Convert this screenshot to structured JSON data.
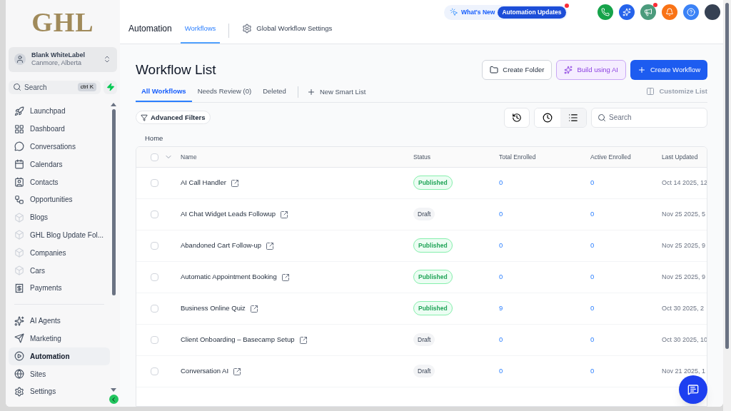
{
  "sidebar": {
    "logo": "GHL",
    "account": {
      "name": "Blank WhiteLabel",
      "location": "Canmore, Alberta"
    },
    "search": {
      "placeholder": "Search",
      "shortcut": "ctrl K"
    },
    "items": [
      {
        "label": "Launchpad",
        "selected": false
      },
      {
        "label": "Dashboard",
        "selected": false
      },
      {
        "label": "Conversations",
        "selected": false
      },
      {
        "label": "Calendars",
        "selected": false
      },
      {
        "label": "Contacts",
        "selected": false
      },
      {
        "label": "Opportunities",
        "selected": false
      },
      {
        "label": "Blogs",
        "selected": false
      },
      {
        "label": "GHL Blog Update Fol...",
        "selected": false
      },
      {
        "label": "Companies",
        "selected": false
      },
      {
        "label": "Cars",
        "selected": false
      },
      {
        "label": "Payments",
        "selected": false
      }
    ],
    "bottom_items": [
      {
        "label": "AI Agents",
        "selected": false
      },
      {
        "label": "Marketing",
        "selected": false
      },
      {
        "label": "Automation",
        "selected": true
      },
      {
        "label": "Sites",
        "selected": false
      },
      {
        "label": "Settings",
        "selected": false
      }
    ]
  },
  "header": {
    "title": "Automation",
    "tabs": [
      {
        "label": "Workflows",
        "selected": true
      },
      {
        "label": "Global Workflow Settings",
        "selected": false
      }
    ],
    "whats_new": "What's New",
    "updates": "Automation Updates",
    "icons": [
      {
        "kind": "phone",
        "color": "#16a34a",
        "dot": false
      },
      {
        "kind": "sparkle",
        "color": "#2563eb",
        "dot": false
      },
      {
        "kind": "megaphone",
        "color": "#4b9b7c",
        "dot": true
      },
      {
        "kind": "bell",
        "color": "#f97316",
        "dot": false
      },
      {
        "kind": "help",
        "color": "#3b82f6",
        "dot": false
      }
    ]
  },
  "page": {
    "title": "Workflow List",
    "buttons": [
      "Create Folder",
      "Build using AI",
      "Create Workflow"
    ],
    "tabs": [
      {
        "label": "All Workflows",
        "selected": true
      },
      {
        "label": "Needs Review (0)",
        "selected": false
      },
      {
        "label": "Deleted",
        "selected": false
      }
    ],
    "new_list": "New Smart List",
    "customize": "Customize List",
    "filters": "Advanced Filters",
    "search": {
      "placeholder": "Search"
    },
    "breadcrumb": "Home"
  },
  "table": {
    "select_all_checked": false,
    "columns": [
      "Name",
      "Status",
      "Total Enrolled",
      "Active Enrolled",
      "Last Updated"
    ],
    "rows": [
      {
        "name": "AI Call Handler",
        "status": "Published",
        "total": "0",
        "active": "0",
        "updated": "Oct 14 2025, 12",
        "checked": false
      },
      {
        "name": "AI Chat Widget Leads Followup",
        "status": "Draft",
        "total": "0",
        "active": "0",
        "updated": "Nov 25 2025, 5",
        "checked": false
      },
      {
        "name": "Abandoned Cart Follow-up",
        "status": "Published",
        "total": "0",
        "active": "0",
        "updated": "Nov 25 2025, 9",
        "checked": false
      },
      {
        "name": "Automatic Appointment Booking",
        "status": "Published",
        "total": "0",
        "active": "0",
        "updated": "Nov 25 2025, 9",
        "checked": false
      },
      {
        "name": "Business Online Quiz",
        "status": "Published",
        "total": "9",
        "active": "0",
        "updated": "Oct 30 2025, 2",
        "checked": false
      },
      {
        "name": "Client Onboarding – Basecamp Setup",
        "status": "Draft",
        "total": "0",
        "active": "0",
        "updated": "Oct 30 2025, 10",
        "checked": false
      },
      {
        "name": "Conversation AI",
        "status": "Draft",
        "total": "0",
        "active": "0",
        "updated": "Nov 21 2025, 1",
        "checked": false
      }
    ]
  }
}
